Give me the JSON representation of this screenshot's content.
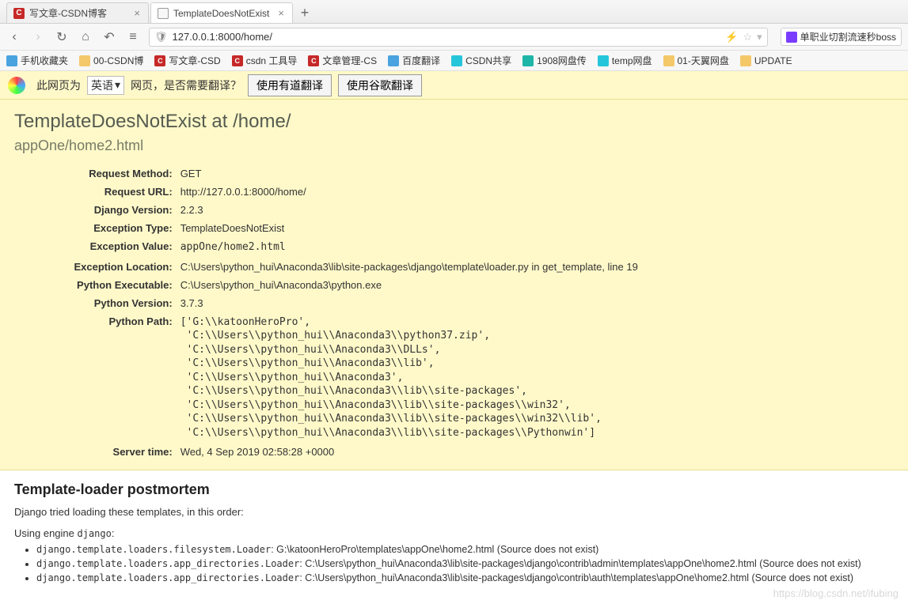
{
  "tabs": {
    "t0": "写文章-CSDN博客",
    "t1": "TemplateDoesNotExist",
    "plus": "+"
  },
  "nav": {
    "url": "127.0.0.1:8000/home/",
    "ext_label": "单职业切割流速秒boss"
  },
  "bookmarks": {
    "b0": "手机收藏夹",
    "b1": "00-CSDN博",
    "b2": "写文章-CSD",
    "b3": "csdn 工具导",
    "b4": "文章管理-CS",
    "b5": "百度翻译",
    "b6": "CSDN共享",
    "b7": "1908网盘传",
    "b8": "temp网盘",
    "b9": "01-天翼网盘",
    "b10": "UPDATE"
  },
  "translate": {
    "prefix": "此网页为",
    "lang": "英语",
    "suffix": "网页，是否需要翻译？",
    "btn1": "使用有道翻译",
    "btn2": "使用谷歌翻译"
  },
  "error": {
    "h1": "TemplateDoesNotExist at /home/",
    "h2": "appOne/home2.html",
    "labels": {
      "method": "Request Method:",
      "url": "Request URL:",
      "djv": "Django Version:",
      "etype": "Exception Type:",
      "eval": "Exception Value:",
      "eloc": "Exception Location:",
      "pexe": "Python Executable:",
      "pver": "Python Version:",
      "ppath": "Python Path:",
      "stime": "Server time:"
    },
    "values": {
      "method": "GET",
      "url": "http://127.0.0.1:8000/home/",
      "djv": "2.2.3",
      "etype": "TemplateDoesNotExist",
      "eval": "appOne/home2.html",
      "eloc": "C:\\Users\\python_hui\\Anaconda3\\lib\\site-packages\\django\\template\\loader.py in get_template, line 19",
      "pexe": "C:\\Users\\python_hui\\Anaconda3\\python.exe",
      "pver": "3.7.3",
      "ppath": "['G:\\\\katoonHeroPro',\n 'C:\\\\Users\\\\python_hui\\\\Anaconda3\\\\python37.zip',\n 'C:\\\\Users\\\\python_hui\\\\Anaconda3\\\\DLLs',\n 'C:\\\\Users\\\\python_hui\\\\Anaconda3\\\\lib',\n 'C:\\\\Users\\\\python_hui\\\\Anaconda3',\n 'C:\\\\Users\\\\python_hui\\\\Anaconda3\\\\lib\\\\site-packages',\n 'C:\\\\Users\\\\python_hui\\\\Anaconda3\\\\lib\\\\site-packages\\\\win32',\n 'C:\\\\Users\\\\python_hui\\\\Anaconda3\\\\lib\\\\site-packages\\\\win32\\\\lib',\n 'C:\\\\Users\\\\python_hui\\\\Anaconda3\\\\lib\\\\site-packages\\\\Pythonwin']",
      "stime": "Wed, 4 Sep 2019 02:58:28 +0000"
    }
  },
  "postmortem": {
    "title": "Template-loader postmortem",
    "intro": "Django tried loading these templates, in this order:",
    "using_prefix": "Using engine ",
    "using_engine": "django",
    "using_suffix": ":",
    "items": [
      {
        "loader": "django.template.loaders.filesystem.Loader",
        "path": "G:\\katoonHeroPro\\templates\\appOne\\home2.html (Source does not exist)"
      },
      {
        "loader": "django.template.loaders.app_directories.Loader",
        "path": "C:\\Users\\python_hui\\Anaconda3\\lib\\site-packages\\django\\contrib\\admin\\templates\\appOne\\home2.html (Source does not exist)"
      },
      {
        "loader": "django.template.loaders.app_directories.Loader",
        "path": "C:\\Users\\python_hui\\Anaconda3\\lib\\site-packages\\django\\contrib\\auth\\templates\\appOne\\home2.html (Source does not exist)"
      }
    ]
  },
  "watermark": "https://blog.csdn.net/ifubing"
}
